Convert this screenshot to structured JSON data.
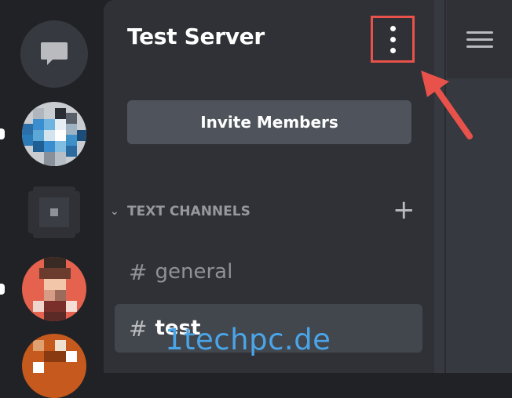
{
  "server": {
    "name": "Test Server",
    "invite_label": "Invite Members"
  },
  "categories": [
    {
      "label": "TEXT CHANNELS"
    }
  ],
  "channels": [
    {
      "label": "general",
      "prefix": "#"
    },
    {
      "label": "test",
      "prefix": "#"
    }
  ],
  "watermark": "1techpc.de",
  "colors": {
    "highlight_box": "#e8524a",
    "watermark": "#4aa5e8",
    "panel_bg": "#2f3136",
    "rail_bg": "#202225"
  },
  "icons": {
    "dm": "chat-bubble-icon",
    "menu": "kebab-menu-icon",
    "add": "plus-icon",
    "hamburger": "hamburger-icon"
  }
}
